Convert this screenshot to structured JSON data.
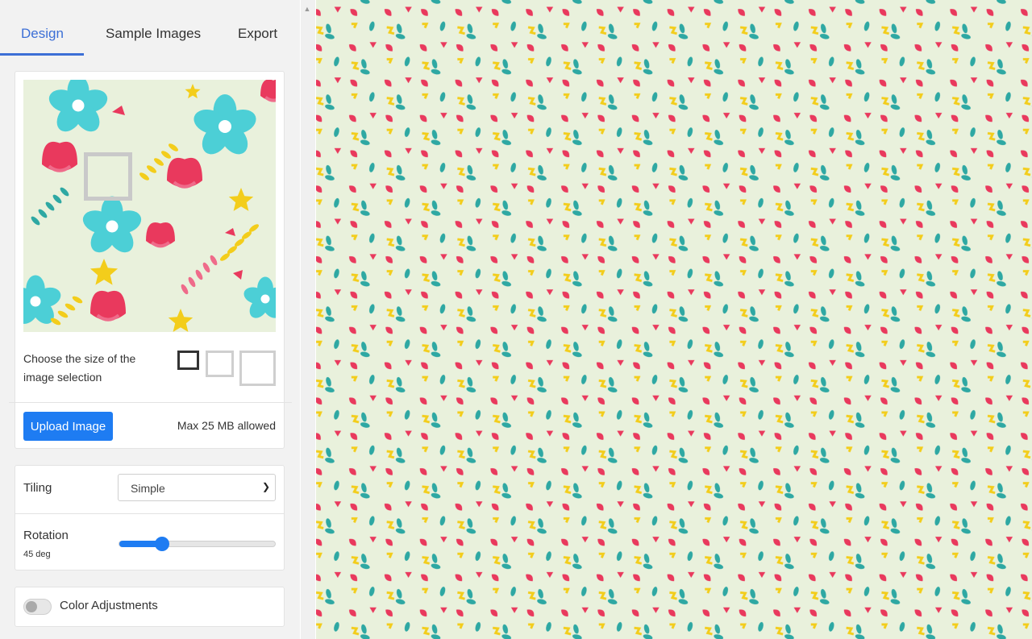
{
  "tabs": [
    {
      "label": "Design",
      "active": true
    },
    {
      "label": "Sample Images",
      "active": false
    },
    {
      "label": "Export",
      "active": false
    }
  ],
  "image_card": {
    "size_label": "Choose the size of the image selection",
    "size_options": [
      "small",
      "medium",
      "large"
    ],
    "selected_size": "small",
    "upload_label": "Upload Image",
    "max_note": "Max 25 MB allowed"
  },
  "settings": {
    "tiling_label": "Tiling",
    "tiling_value": "Simple",
    "rotation_label": "Rotation",
    "rotation_value": "45 deg",
    "rotation_fraction": 0.27
  },
  "color": {
    "label": "Color Adjustments",
    "enabled": false
  },
  "colors": {
    "accent": "#1e7cf2",
    "tab_active": "#3c6fd6",
    "pattern_bg": "#e9f1dc",
    "pattern_red": "#e9395d",
    "pattern_teal": "#2ea8a3",
    "pattern_yellow": "#f3cd1b",
    "pattern_cyan": "#4ccfd6",
    "pattern_pink": "#ef6b8a"
  }
}
